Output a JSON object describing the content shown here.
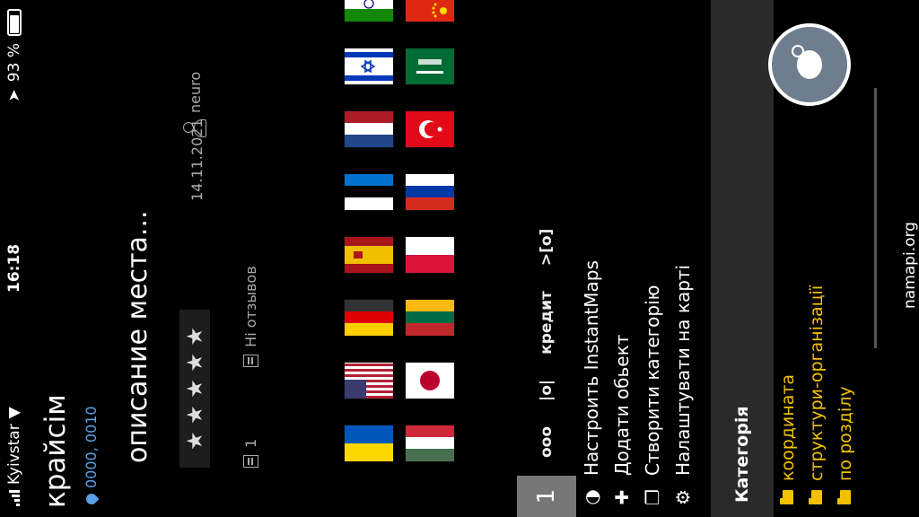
{
  "status_bar": {
    "carrier": "Kyivstar",
    "time": "16:18",
    "battery": "93 %",
    "battery_level": 0.93
  },
  "place": {
    "name": "крайсім",
    "coords": "0000, 0010",
    "description": "описание места...",
    "rating_stars": "★ ★ ★ ★ ★",
    "date": "14.11.2021",
    "author": "neuro",
    "comments_count": "1",
    "reviews_label": "Hi отзывов"
  },
  "flags": [
    {
      "name": "ukraine",
      "colors": [
        "#0057b7",
        "#ffd700"
      ]
    },
    {
      "name": "usa",
      "colors": [
        "#b22234",
        "#ffffff",
        "#3c3b6e"
      ]
    },
    {
      "name": "germany",
      "colors": [
        "#000000",
        "#dd0000",
        "#ffce00"
      ]
    },
    {
      "name": "spain",
      "colors": [
        "#aa151b",
        "#f1bf00"
      ]
    },
    {
      "name": "estonia",
      "colors": [
        "#0072ce",
        "#000000",
        "#ffffff"
      ]
    },
    {
      "name": "netherlands",
      "colors": [
        "#ae1c28",
        "#ffffff",
        "#21468b"
      ]
    },
    {
      "name": "israel",
      "colors": [
        "#ffffff",
        "#0038b8"
      ]
    },
    {
      "name": "india",
      "colors": [
        "#ff9933",
        "#ffffff",
        "#138808"
      ]
    },
    {
      "name": "hungary",
      "colors": [
        "#ce2939",
        "#ffffff",
        "#477050"
      ]
    },
    {
      "name": "japan",
      "colors": [
        "#ffffff",
        "#bc002d"
      ]
    },
    {
      "name": "lithuania",
      "colors": [
        "#fdb913",
        "#006a44",
        "#c1272d"
      ]
    },
    {
      "name": "poland",
      "colors": [
        "#ffffff",
        "#dc143c"
      ]
    },
    {
      "name": "russia",
      "colors": [
        "#ffffff",
        "#0039a6",
        "#d52b1e"
      ]
    },
    {
      "name": "turkey",
      "colors": [
        "#e30a17",
        "#ffffff"
      ]
    },
    {
      "name": "saudi-arabia",
      "colors": [
        "#006c35",
        "#ffffff"
      ]
    },
    {
      "name": "china",
      "colors": [
        "#de2910",
        "#ffde00"
      ]
    }
  ],
  "panel": {
    "tab_number": "1",
    "tab_buttons": [
      "ooo",
      "|o|",
      "кредит",
      ">[o]"
    ],
    "menu": [
      {
        "icon": "circle-logo-icon",
        "label": "Настроить InstantMaps"
      },
      {
        "icon": "plus-icon",
        "label": "Додати обьект"
      },
      {
        "icon": "new-folder-icon",
        "label": "Створити категорію"
      },
      {
        "icon": "gear-icon",
        "label": "Налаштувати на карті"
      }
    ],
    "category_header": "Категорія",
    "categories": [
      "координата",
      "структури-організації",
      "по розділу"
    ],
    "site": "namapi.org"
  }
}
